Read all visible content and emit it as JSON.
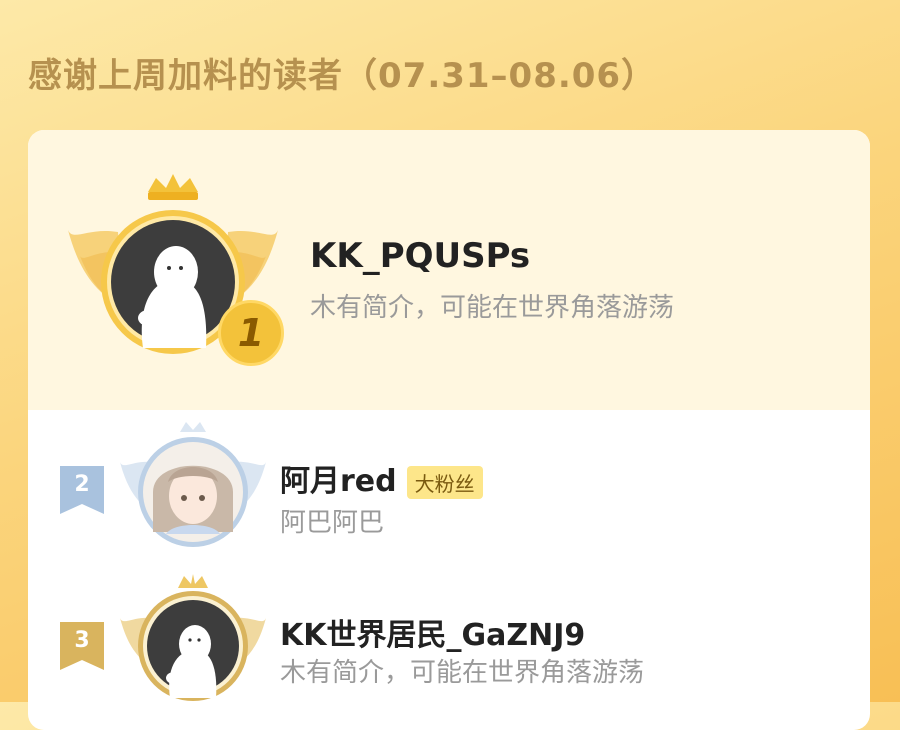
{
  "header": {
    "title": "感谢上周加料的读者（07.31–08.06）"
  },
  "leaderboard": [
    {
      "rank": "1",
      "name": "KK_PQUSPs",
      "bio": "木有简介，可能在世界角落游荡",
      "avatar": "default-ghost-avatar",
      "frame": "gold-crown-wings"
    },
    {
      "rank": "2",
      "name": "阿月red",
      "badge": "大粉丝",
      "bio": "阿巴阿巴",
      "avatar": "anime-girl-avatar",
      "frame": "silver-wings"
    },
    {
      "rank": "3",
      "name": "KK世界居民_GaZNJ9",
      "bio": "木有简介，可能在世界角落游荡",
      "avatar": "default-ghost-avatar",
      "frame": "bronze-crown-wings"
    }
  ],
  "colors": {
    "gold": "#f3c23a",
    "silver": "#9fbbd8",
    "bronze": "#d9b45e",
    "title": "#b6914f"
  }
}
